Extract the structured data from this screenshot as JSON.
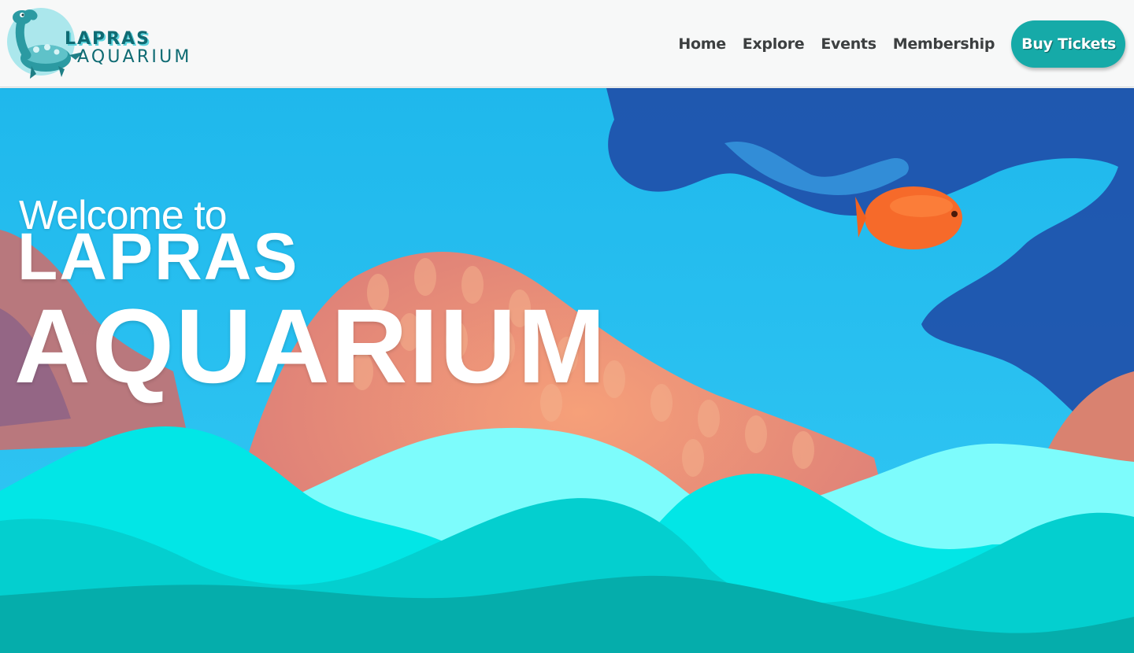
{
  "header": {
    "logo": {
      "line1": "LAPRAS",
      "line2": "AQUARIUM",
      "icon": "lapras-icon"
    },
    "nav": {
      "items": [
        {
          "label": "Home"
        },
        {
          "label": "Explore"
        },
        {
          "label": "Events"
        },
        {
          "label": "Membership"
        }
      ],
      "cta_label": "Buy Tickets"
    }
  },
  "hero": {
    "welcome": "Welcome to",
    "title_line1": "LAPRAS",
    "title_line2": "AQUARIUM",
    "background": "coral-reef-with-orange-fish"
  },
  "colors": {
    "brand_dark": "#0f6b73",
    "brand_accent": "#16aaa8",
    "nav_text": "#3c3f40",
    "wave_light": "#7dfcfc",
    "wave_mid": "#02e6e6",
    "wave_deep": "#04cfcf",
    "wave_deepest": "#05adab",
    "water": "#29bdf0"
  }
}
